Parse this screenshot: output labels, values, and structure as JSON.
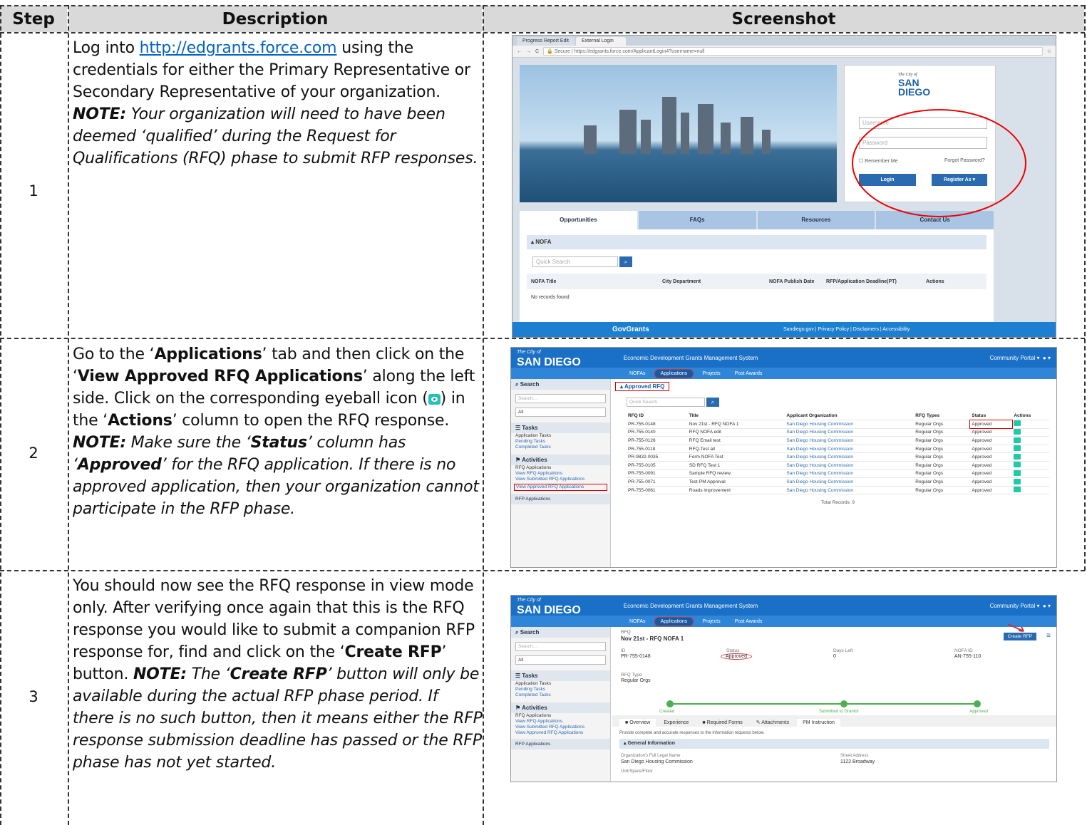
{
  "headers": {
    "step": "Step",
    "description": "Description",
    "screenshot": "Screenshot"
  },
  "rows": [
    {
      "step": "1"
    },
    {
      "step": "2"
    },
    {
      "step": "3"
    }
  ],
  "row1": {
    "p1": "Log into ",
    "link": "http://edgrants.force.com",
    "p2": " using the credentials for either the Primary Representative or Secondary Representative of your organization. ",
    "note": "NOTE:",
    "p3": " Your organization will need to have been deemed ‘qualified’ during the Request for Qualifications (RFQ) phase to submit RFP responses."
  },
  "row2": {
    "p1": "Go to the ‘",
    "b1": "Applications",
    "p2": "’ tab and then click on the ‘",
    "b2": "View Approved RFQ Applications",
    "p3": "’ along the left side. Click on the corresponding eyeball icon (",
    "p4": ") in the ‘",
    "b3": "Actions",
    "p5": "’ column to open the RFQ response. ",
    "note": "NOTE:",
    "p6": " Make sure the ‘",
    "b4": "Status",
    "p7": "’ column has ‘",
    "b5": "Approved",
    "p8": "’ for the RFQ application. If there is no approved application, then your organization cannot participate in the RFP phase."
  },
  "row3": {
    "p1": "You should now see the RFQ response in view mode only. After verifying once again that this is the RFQ response you would like to submit a companion RFP response for, find and click on the ‘",
    "b1": "Create RFP",
    "p2": "’ button. ",
    "note": "NOTE:",
    "p3": " The ‘",
    "b2": "Create RFP",
    "p4": "’ button will only be available during the actual RFP phase period. If there is no such button, then it means either the RFP response submission deadline has passed or the RFP phase has not yet started."
  },
  "shot1": {
    "tab1": "Progress Report Edit",
    "tab2": "External Login",
    "secure": "Secure",
    "url": "https://edgrants.force.com/ApplicantLogin4?username=null",
    "city": "The City of",
    "logo": "SAN DIEGO",
    "username": "Username",
    "password": "Password",
    "remember": "Remember Me",
    "forgot": "Forgot Password?",
    "login": "Login",
    "register": "Register As",
    "tabs": [
      "Opportunities",
      "FAQs",
      "Resources",
      "Contact Us"
    ],
    "nofa": "NOFA",
    "quicksearch": "Quick Search",
    "cols": [
      "NOFA Title",
      "City Department",
      "NOFA Publish Date",
      "RFP/Application Deadline(PT)",
      "Actions"
    ],
    "norecords": "No records found",
    "govgrants": "GovGrants",
    "footer": "Sandiego.gov | Privacy Policy | Disclaimers | Accessibility"
  },
  "app": {
    "city": "The City of",
    "logo": "SAN DIEGO",
    "system": "Economic Development Grants Management System",
    "portal": "Community Portal",
    "nav": [
      "NOFAs",
      "Applications",
      "Projects",
      "Post Awards"
    ],
    "search": "Search",
    "searchph": "Search...",
    "all": "All",
    "tasks": "Tasks",
    "apptasks": "Application Tasks",
    "pending": "Pending Tasks",
    "completed": "Completed Tasks",
    "activities": "Activities",
    "rfqapps": "RFQ Applications",
    "view1": "View RFQ Applications",
    "view2": "View Submitted RFQ Applications",
    "view3": "View Approved RFQ Applications",
    "rfpapps": "RFP Applications"
  },
  "shot2": {
    "section": "Approved RFQ",
    "quicksearch": "Quick Search",
    "cols": [
      "RFQ ID",
      "Title",
      "Applicant Organization",
      "RFQ Types",
      "Status",
      "Actions"
    ],
    "records": [
      [
        "PR-755-0148",
        "Nov 21st - RFQ NOFA 1",
        "San Diego Housing Commission",
        "Regular Orgs",
        "Approved"
      ],
      [
        "PR-755-0140",
        "RFQ NOFA edit",
        "San Diego Housing Commission",
        "Regular Orgs",
        "Approved"
      ],
      [
        "PR-755-0126",
        "RFQ Email test",
        "San Diego Housing Commission",
        "Regular Orgs",
        "Approved"
      ],
      [
        "PR-755-0118",
        "RFQ-Test all",
        "San Diego Housing Commission",
        "Regular Orgs",
        "Approved"
      ],
      [
        "PR-9832-0035",
        "Form NOFA Test",
        "San Diego Housing Commission",
        "Regular Orgs",
        "Approved"
      ],
      [
        "PR-755-0105",
        "SD RFQ Test 1",
        "San Diego Housing Commission",
        "Regular Orgs",
        "Approved"
      ],
      [
        "PR-755-0091",
        "Sample RFQ review",
        "San Diego Housing Commission",
        "Regular Orgs",
        "Approved"
      ],
      [
        "PR-755-0071",
        "Test-PM Approval",
        "San Diego Housing Commission",
        "Regular Orgs",
        "Approved"
      ],
      [
        "PR-755-0061",
        "Roads improvement",
        "San Diego Housing Commission",
        "Regular Orgs",
        "Approved"
      ]
    ],
    "total": "Total Records: 9"
  },
  "shot3": {
    "rfq": "RFQ",
    "title": "Nov 21st - RFQ NOFA 1",
    "create": "Create RFP",
    "idlabel": "ID",
    "idval": "PR-755-0148",
    "statuslabel": "Status",
    "statusval": "Approved",
    "dayslabel": "Days Left",
    "daysval": "0",
    "nofalabel": "NOFA ID",
    "nofaval": "AN-755-110",
    "typelabel": "RFQ Type",
    "typeval": "Regular Orgs",
    "stages": [
      "Created",
      "Submitted to Grantor",
      "Approved"
    ],
    "tabs": [
      "Overview",
      "Experience",
      "Required Forms",
      "Attachments",
      "PM Instruction"
    ],
    "instr": "Provide complete and accurate responses to the information requests below.",
    "general": "General Information",
    "orglabel": "Organization's Full Legal Name",
    "orgval": "San Diego Housing Commission",
    "streetlabel": "Street Address",
    "streetval": "1122 Broadway",
    "unitlabel": "Unit/Space/Floor"
  }
}
